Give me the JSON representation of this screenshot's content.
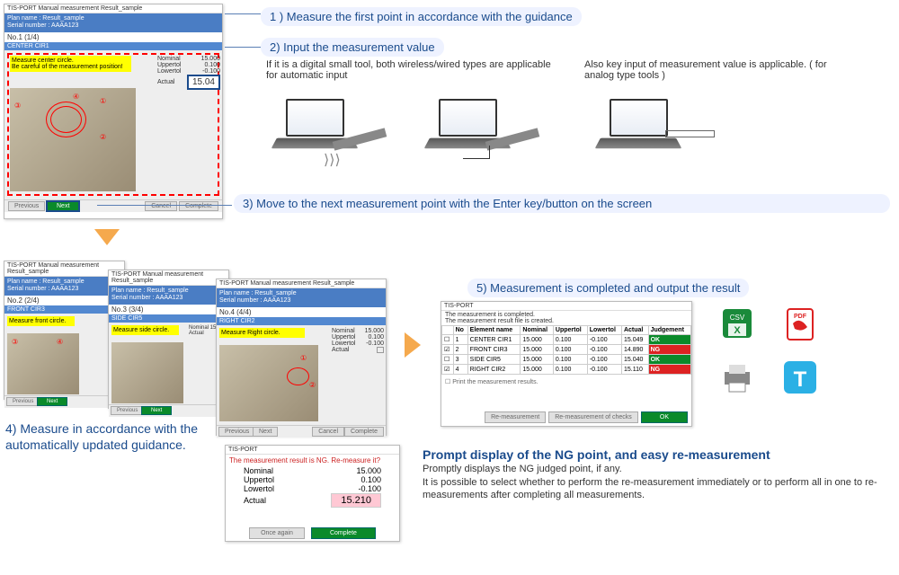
{
  "steps": {
    "s1": "1 ) Measure the first point in accordance with the guidance",
    "s2": "2) Input the measurement value",
    "s2_sub1": "If it is a digital small tool, both wireless/wired types are applicable for automatic input",
    "s2_sub2": "Also key input of measurement value is applicable. ( for analog type tools )",
    "s3": "3) Move to the next measurement point with the Enter key/button on the screen",
    "s4": "4) Measure in accordance with the automatically updated guidance.",
    "s5": "5) Measurement is completed and output the result"
  },
  "bottom": {
    "title": "Prompt display of the NG point, and easy re-measurement",
    "line1": "Promptly displays the NG judged point, if any.",
    "line2": "It is possible to select whether to perform the re-measurement immediately or to perform all in one to re-measurements after completing all measurements."
  },
  "app": {
    "title_prefix": "TIS-PORT Manual measurement Result_sample",
    "plan": "Plan name : Result_sample",
    "serial": "Serial number : AAAA123",
    "no1": "No.1 (1/4)",
    "no2": "No.2 (2/4)",
    "no3": "No.3 (3/4)",
    "no4": "No.4 (4/4)",
    "elem1": "CENTER CIR1",
    "elem2": "FRONT CIR3",
    "elem3": "SIDE CIR5",
    "elem4": "RIGHT CIR2",
    "msg1a": "Measure center circle.",
    "msg1b": "Be careful of the measurement position!",
    "msg2": "Measure front circle.",
    "msg3": "Measure side circle.",
    "msg4": "Measure Right circle.",
    "nominal_l": "Nominal",
    "nominal_v": "15.000",
    "upper_l": "Uppertol",
    "upper_v": "0.100",
    "lower_l": "Lowertol",
    "lower_v": "-0.100",
    "actual_l": "Actual",
    "actual_v": "15.04",
    "prev": "Previous",
    "next": "Next",
    "cancel": "Cancel",
    "complete": "Complete"
  },
  "ng_dialog": {
    "title": "TIS-PORT",
    "msg": "The measurement result is NG. Re-measure it?",
    "nominal_l": "Nominal",
    "nominal_v": "15.000",
    "upper_l": "Uppertol",
    "upper_v": "0.100",
    "lower_l": "Lowertol",
    "lower_v": "-0.100",
    "actual_l": "Actual",
    "actual_v": "15.210",
    "once": "Once again",
    "complete": "Complete"
  },
  "result": {
    "title": "TIS-PORT",
    "msg1": "The measurement is completed.",
    "msg2": "The measurement result file is created.",
    "h_no": "No",
    "h_name": "Element name",
    "h_nom": "Nominal",
    "h_up": "Uppertol",
    "h_low": "Lowertol",
    "h_act": "Actual",
    "h_j": "Judgement",
    "rows": [
      {
        "no": "1",
        "name": "CENTER CIR1",
        "nom": "15.000",
        "up": "0.100",
        "low": "-0.100",
        "act": "15.049",
        "j": "OK"
      },
      {
        "no": "2",
        "name": "FRONT CIR3",
        "nom": "15.000",
        "up": "0.100",
        "low": "-0.100",
        "act": "14.890",
        "j": "NG"
      },
      {
        "no": "3",
        "name": "SIDE CIR5",
        "nom": "15.000",
        "up": "0.100",
        "low": "-0.100",
        "act": "15.040",
        "j": "OK"
      },
      {
        "no": "4",
        "name": "RIGHT CIR2",
        "nom": "15.000",
        "up": "0.100",
        "low": "-0.100",
        "act": "15.110",
        "j": "NG"
      }
    ],
    "print": "Print the measurement results.",
    "remeasure": "Re-measurement",
    "rechecks": "Re-measurement of checks",
    "ok": "OK"
  },
  "icons": {
    "csv": "CSV",
    "pdf": "PDF"
  }
}
